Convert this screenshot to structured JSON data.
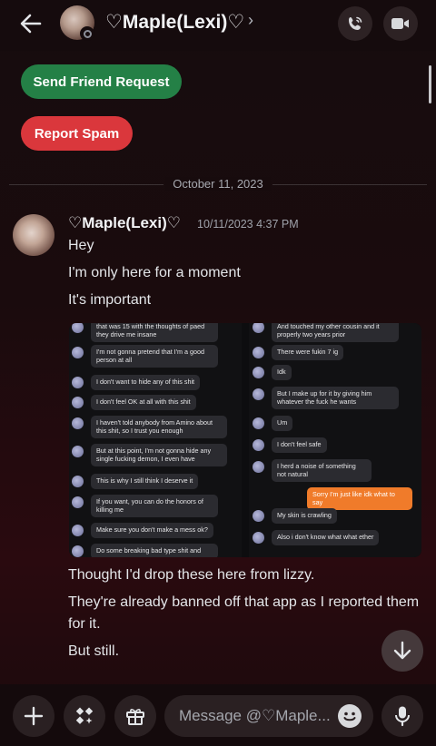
{
  "header": {
    "name": "♡Maple(Lexi)♡",
    "chevron": "›",
    "icons": [
      "back-arrow-icon",
      "phone-icon",
      "video-camera-icon"
    ]
  },
  "actions": {
    "friend_request": "Send Friend Request",
    "report_spam": "Report Spam"
  },
  "date_divider": "October 11, 2023",
  "message": {
    "author": "♡Maple(Lexi)♡",
    "timestamp": "10/11/2023 4:37 PM",
    "lines": [
      "Hey",
      "I'm only here for a moment",
      "It's important"
    ],
    "lines_after": [
      "Thought I'd drop these here from lizzy.",
      "They're already banned off that app as I reported them for it.",
      "But still."
    ]
  },
  "attachment": {
    "left": [
      "that was 15 with the thoughts of paed they drive me insane",
      "I'm not gonna pretend that I'm a good person at all",
      "I don't want to hide any of this shit",
      "I don't feel OK at all with this shit",
      "I haven't told anybody from Amino about this shit, so I trust you enough",
      "But at this point, I'm not gonna hide any single fucking demon, I even have",
      "This is why I still think I deserve it",
      "If you want, you can do the honors of killing me",
      "Make sure you don't make a mess ok?",
      "Do some breaking bad type shit and"
    ],
    "right": [
      "And touched my other cousin and it properly two years prior",
      "There were fukin 7 ig",
      "Idk",
      "But I make up for it by giving him whatever the fuck he wants",
      "Um",
      "I don't feel safe",
      "I herd a noise of something not natural",
      "Sorry I'm just like idk what to say",
      "My skin is crawling",
      "Also i don't know what what ether"
    ]
  },
  "composer": {
    "placeholder": "Message @♡Maple...",
    "icons": [
      "plus-icon",
      "apps-icon",
      "gift-icon",
      "emoji-icon",
      "microphone-icon"
    ]
  },
  "colors": {
    "green": "#248046",
    "red": "#da373c",
    "orange_bubble": "#f07b2a"
  }
}
